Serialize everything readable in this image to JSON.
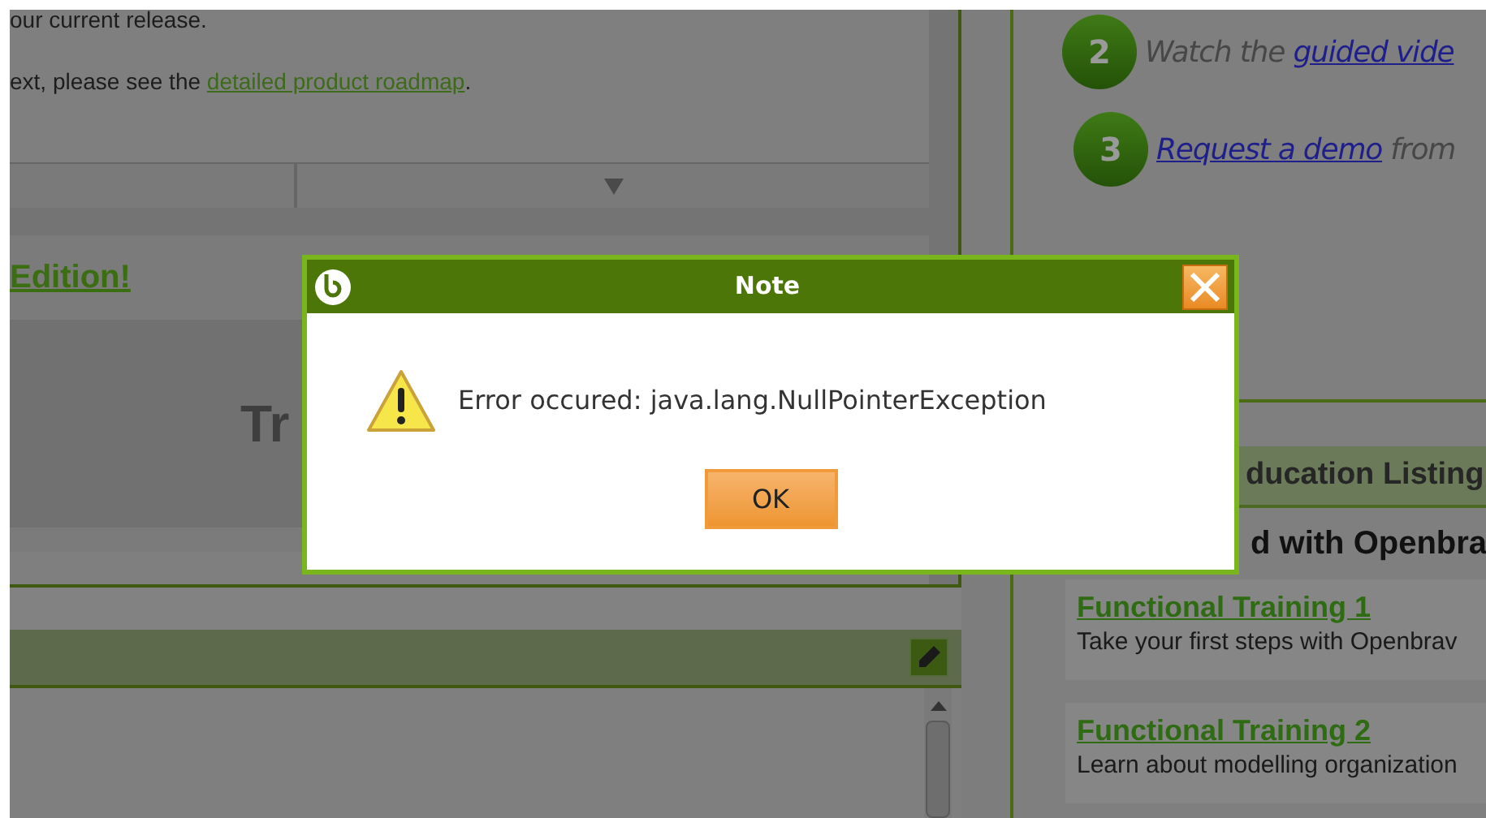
{
  "left_panel": {
    "intro_line": "our current release.",
    "roadmap_sentence": {
      "before": "ext, please see the ",
      "link": "detailed product roadmap",
      "after": "."
    },
    "edition_heading": "Edition!",
    "promo_text": "Tr"
  },
  "right_panel": {
    "steps": [
      {
        "number": "2",
        "before": "Watch the ",
        "link": "guided vide"
      },
      {
        "number": "3",
        "link": "Request a demo",
        "after": " from"
      }
    ],
    "education": {
      "header": "ducation Listing",
      "subtitle": "d with Openbra",
      "courses": [
        {
          "title": "Functional Training 1",
          "description": "Take your first steps with Openbrav"
        },
        {
          "title": "Functional Training 2",
          "description": "Learn about modelling organization"
        }
      ]
    }
  },
  "dialog": {
    "title": "Note",
    "message": "Error occured: java.lang.NullPointerException",
    "buttons": [
      "OK"
    ]
  }
}
